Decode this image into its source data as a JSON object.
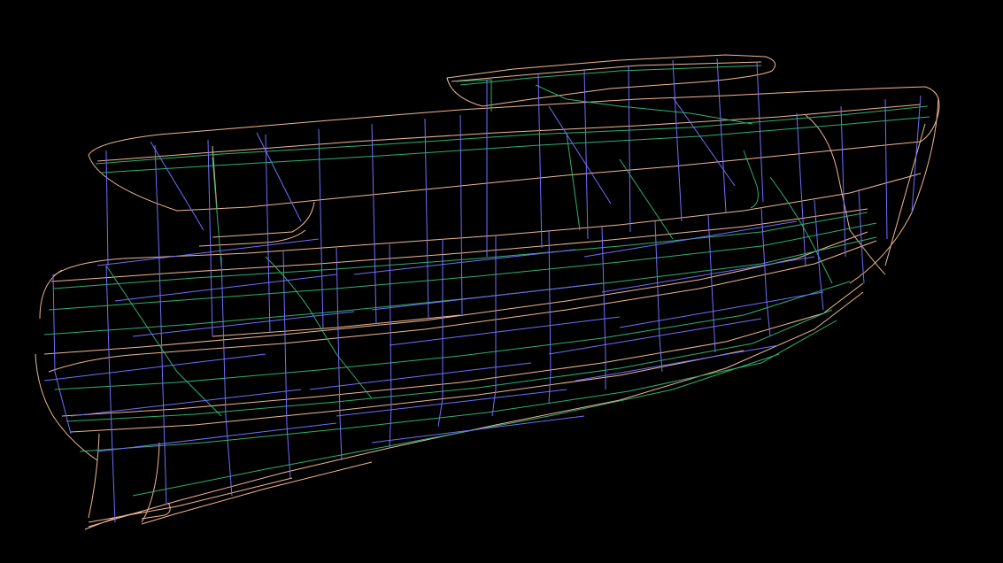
{
  "scene": {
    "background": "#000000",
    "subject": "boat-hull-wireframe",
    "colors": {
      "outline": "#f0b890",
      "waterlines": "#2fb070",
      "stations": "#6f6fff"
    }
  }
}
